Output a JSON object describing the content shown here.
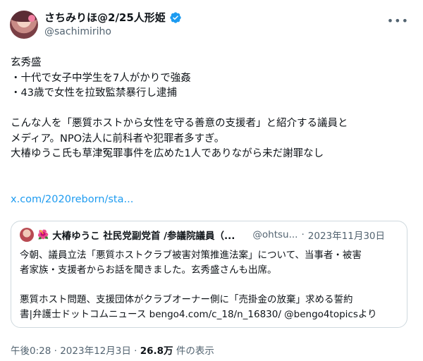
{
  "author": {
    "display_name": "さちみりほ@2/25人形姫",
    "handle": "@sachimiriho",
    "verified": true
  },
  "more_icon": "more-icon",
  "tweet_text": "玄秀盛\n・十代で女子中学生を7人がかりで強姦\n・43歳で女性を拉致監禁暴行し逮捕\n\nこんな人を「悪質ホストから女性を守る善意の支援者」と紹介する議員と\nメディア。NPO法人に前科者や犯罪者多すぎ。\n大椿ゆうこ氏も草津冤罪事件を広めた1人でありながら未だ謝罪なし",
  "link_text": "x.com/2020reborn/sta...",
  "quote": {
    "emoji": "🌺",
    "name": "大椿ゆうこ 社民党副党首 /参議院議員（...",
    "handle": "@ohtsu...",
    "separator": "·",
    "date": "2023年11月30日",
    "text": "今朝、議員立法「悪質ホストクラブ被害対策推進法案」について、当事者・被害\n者家族・支援者からお話を聞きました。玄秀盛さんも出席。\n\n悪質ホスト問題、支援団体がクラブオーナー側に「売掛金の放棄」求める誓約\n書|弁護士ドットコムニュース bengo4.com/c_18/n_16830/ @bengo4topicsより"
  },
  "meta": {
    "time": "午後0:28",
    "separator": "·",
    "date": "2023年12月3日",
    "dot": "·",
    "views_count": "26.8万",
    "views_label": "件の表示"
  },
  "colors": {
    "accent": "#1d9bf0",
    "muted": "#536471",
    "border": "#cfd9de"
  }
}
